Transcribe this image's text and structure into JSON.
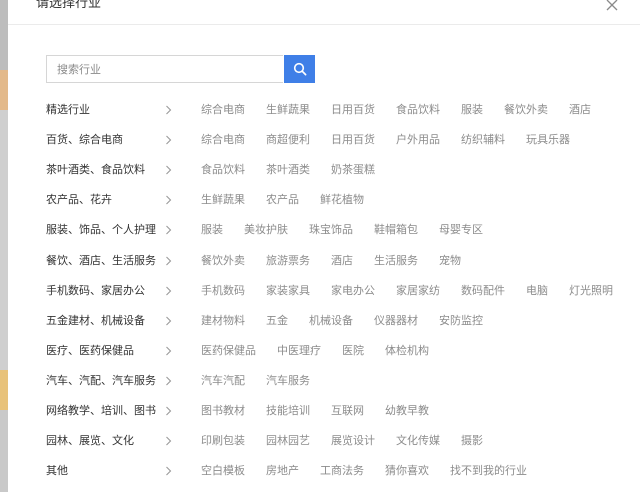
{
  "modal": {
    "title": "请选择行业"
  },
  "search": {
    "placeholder": "搜索行业"
  },
  "icons": {
    "close": "close-icon",
    "search": "search-icon",
    "chevron": "chevron-right-icon"
  },
  "colors": {
    "accent": "#3f7fe7",
    "category_text": "#333333",
    "sub_text": "#8c8c8c"
  },
  "categories": [
    {
      "label": "精选行业",
      "subs": [
        "综合电商",
        "生鲜蔬果",
        "日用百货",
        "食品饮料",
        "服装",
        "餐饮外卖",
        "酒店"
      ]
    },
    {
      "label": "百货、综合电商",
      "subs": [
        "综合电商",
        "商超便利",
        "日用百货",
        "户外用品",
        "纺织辅料",
        "玩具乐器"
      ]
    },
    {
      "label": "茶叶酒类、食品饮料",
      "subs": [
        "食品饮料",
        "茶叶酒类",
        "奶茶蛋糕"
      ]
    },
    {
      "label": "农产品、花卉",
      "subs": [
        "生鲜蔬果",
        "农产品",
        "鲜花植物"
      ]
    },
    {
      "label": "服装、饰品、个人护理",
      "subs": [
        "服装",
        "美妆护肤",
        "珠宝饰品",
        "鞋帽箱包",
        "母婴专区"
      ]
    },
    {
      "label": "餐饮、酒店、生活服务",
      "subs": [
        "餐饮外卖",
        "旅游票务",
        "酒店",
        "生活服务",
        "宠物"
      ]
    },
    {
      "label": "手机数码、家居办公",
      "subs": [
        "手机数码",
        "家装家具",
        "家电办公",
        "家居家纺",
        "数码配件",
        "电脑",
        "灯光照明"
      ]
    },
    {
      "label": "五金建材、机械设备",
      "subs": [
        "建材物料",
        "五金",
        "机械设备",
        "仪器器材",
        "安防监控"
      ]
    },
    {
      "label": "医疗、医药保健品",
      "subs": [
        "医药保健品",
        "中医理疗",
        "医院",
        "体检机构"
      ]
    },
    {
      "label": "汽车、汽配、汽车服务",
      "subs": [
        "汽车汽配",
        "汽车服务"
      ]
    },
    {
      "label": "网络教学、培训、图书",
      "subs": [
        "图书教材",
        "技能培训",
        "互联网",
        "幼教早教"
      ]
    },
    {
      "label": "园林、展览、文化",
      "subs": [
        "印刷包装",
        "园林园艺",
        "展览设计",
        "文化传媒",
        "摄影"
      ]
    },
    {
      "label": "其他",
      "subs": [
        "空白模板",
        "房地产",
        "工商法务",
        "猜你喜欢",
        "找不到我的行业"
      ]
    }
  ]
}
